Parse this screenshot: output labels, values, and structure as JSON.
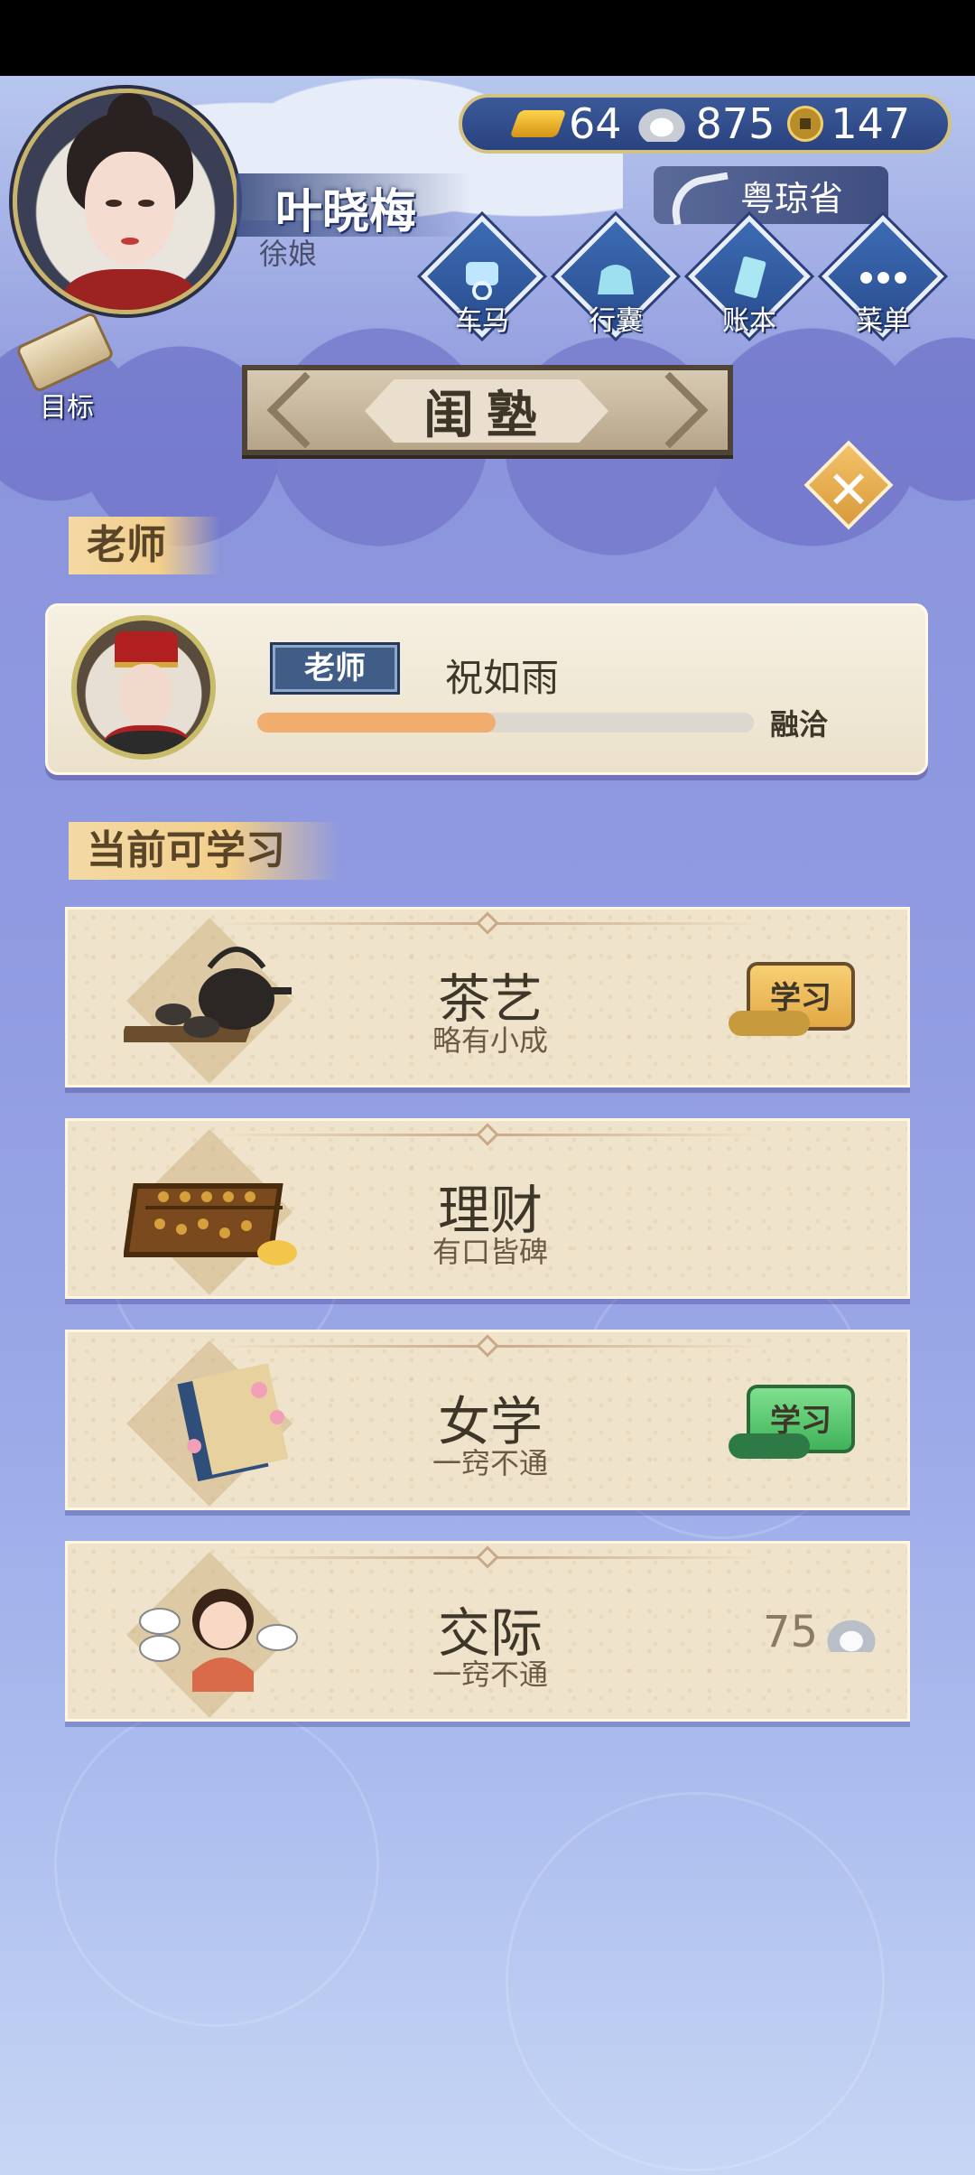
{
  "player": {
    "name": "叶晓梅",
    "title": "徐娘"
  },
  "currency": {
    "gold": "64",
    "silver": "875",
    "coins": "147"
  },
  "region": {
    "label": "粤琼省"
  },
  "nav": [
    {
      "label": "车马",
      "icon": "carriage-icon"
    },
    {
      "label": "行囊",
      "icon": "bag-icon"
    },
    {
      "label": "账本",
      "icon": "ledger-icon"
    },
    {
      "label": "菜单",
      "icon": "menu-icon"
    }
  ],
  "goal": {
    "label": "目标"
  },
  "page": {
    "title": "闺塾"
  },
  "teacher_section": {
    "heading": "老师",
    "role_tag": "老师",
    "name": "祝如雨",
    "bond_label": "融洽",
    "bond_progress": 0.48
  },
  "skills_section": {
    "heading": "当前可学习",
    "items": [
      {
        "name": "茶艺",
        "level": "略有小成",
        "action": "学习",
        "action_style": "gold",
        "icon": "tea-set-icon"
      },
      {
        "name": "理财",
        "level": "有口皆碑",
        "icon": "abacus-icon"
      },
      {
        "name": "女学",
        "level": "一窍不通",
        "action": "学习",
        "action_style": "green",
        "icon": "book-icon"
      },
      {
        "name": "交际",
        "level": "一窍不通",
        "price": "75",
        "icon": "chatting-girl-icon"
      }
    ]
  },
  "colors": {
    "background": "#8f9ae0",
    "card": "#efe4cb",
    "accent_gold": "#e3a846",
    "accent_green": "#3fb35a",
    "text_dark": "#3e3628"
  }
}
